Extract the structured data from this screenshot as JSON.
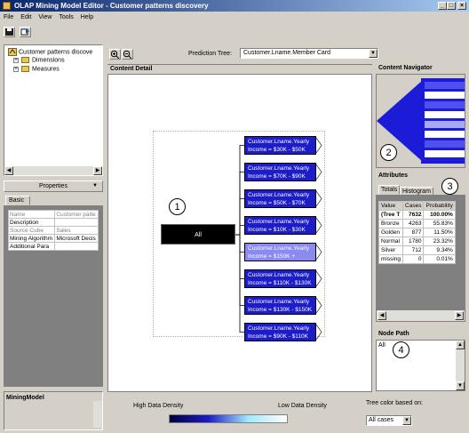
{
  "window": {
    "title": "OLAP Mining Model Editor - Customer patterns discovery"
  },
  "menu": [
    "File",
    "Edit",
    "View",
    "Tools",
    "Help"
  ],
  "tree": {
    "root": "Customer patterns discove",
    "children": [
      "Dimensions",
      "Measures"
    ]
  },
  "properties": {
    "header": "Properties",
    "tab": "Basic",
    "rows": [
      [
        "Name",
        "Customer patte"
      ],
      [
        "Description",
        ""
      ],
      [
        "Source Cube",
        "Sales"
      ],
      [
        "Mining Algorithm",
        "Microsoft Decis"
      ],
      [
        "Additional Para",
        ""
      ]
    ]
  },
  "bottom_left": {
    "label": "MiningModel"
  },
  "prediction_tree": {
    "label": "Prediction Tree:",
    "value": "Customer.Lname.Member Card"
  },
  "content_detail": {
    "header": "Content Detail"
  },
  "diagram": {
    "root": "All",
    "nodes": [
      "Customer.Lname.Yearly Income = $30K - $50K",
      "Customer.Lname.Yearly Income = $70K - $90K",
      "Customer.Lname.Yearly Income = $50K - $70K",
      "Customer.Lname.Yearly Income = $10K - $30K",
      "Customer.Lname.Yearly Income = $150K +",
      "Customer.Lname.Yearly Income = $110K - $130K",
      "Customer.Lname.Yearly Income = $130K - $150K",
      "Customer.Lname.Yearly Income = $90K - $110K"
    ],
    "highlighted_index": 4
  },
  "callouts": [
    "1",
    "2",
    "3",
    "4"
  ],
  "content_navigator": {
    "header": "Content Navigator"
  },
  "attributes": {
    "header": "Attributes",
    "tabs": [
      "Totals",
      "Histogram"
    ],
    "columns": [
      "Value",
      "Cases",
      "Probability"
    ],
    "rows": [
      [
        "(Tree T",
        "7632",
        "100.00%"
      ],
      [
        "Bronze",
        "4263",
        "55.83%"
      ],
      [
        "Golden",
        "877",
        "11.50%"
      ],
      [
        "Normal",
        "1780",
        "23.32%"
      ],
      [
        "Silver",
        "712",
        "9.34%"
      ],
      [
        "missing",
        "0",
        "0.01%"
      ]
    ]
  },
  "node_path": {
    "header": "Node Path",
    "value": "All"
  },
  "legend": {
    "high": "High Data Density",
    "low": "Low Data Density"
  },
  "tree_color": {
    "label": "Tree color based on:",
    "value": "All cases"
  },
  "colors": {
    "node": "#1c1cc8",
    "node_highlight": "#8a8af0",
    "root": "#000000",
    "titlebar": "#0a246a"
  }
}
